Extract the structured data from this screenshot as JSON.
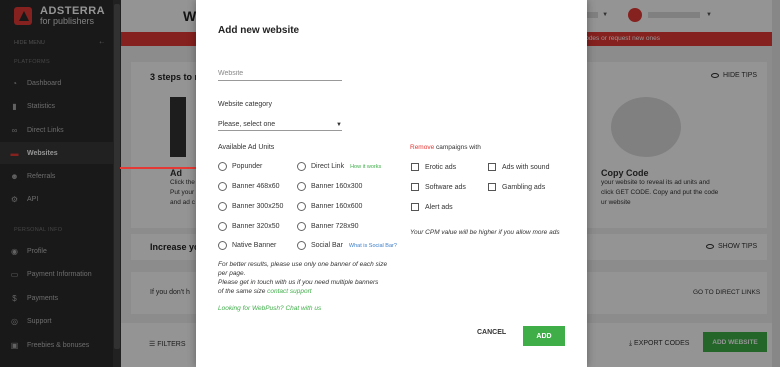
{
  "sidebar": {
    "logo_title": "ADSTERRA",
    "logo_sub": "for publishers",
    "hide_menu": "HIDE MENU",
    "platforms_label": "PLATFORMS",
    "personal_label": "PERSONAL INFO",
    "items": [
      {
        "label": "Dashboard",
        "icon": "dashboard-icon"
      },
      {
        "label": "Statistics",
        "icon": "statistics-icon"
      },
      {
        "label": "Direct Links",
        "icon": "link-icon"
      },
      {
        "label": "Websites",
        "icon": "websites-icon"
      },
      {
        "label": "Referrals",
        "icon": "referrals-icon"
      },
      {
        "label": "API",
        "icon": "api-icon"
      },
      {
        "label": "Profile",
        "icon": "profile-icon"
      },
      {
        "label": "Payment Information",
        "icon": "payment-icon"
      },
      {
        "label": "Payments",
        "icon": "dollar-icon"
      },
      {
        "label": "Support",
        "icon": "support-icon"
      },
      {
        "label": "Freebies & bonuses",
        "icon": "gift-icon"
      }
    ]
  },
  "main": {
    "page_title": "We",
    "banner_text": "the your codes or request new ones",
    "steps_title": "3 steps to m",
    "hide_tips": "HIDE TIPS",
    "step_1": {
      "head": "Ad",
      "lines": [
        "Click the",
        "Put your",
        "and ad c"
      ]
    },
    "step_3": {
      "head": "Copy Code",
      "lines": [
        "your website to reveal its ad units and",
        "click GET CODE. Copy and put the code",
        "ur website"
      ]
    },
    "increase_title": "Increase yo",
    "show_tips": "SHOW TIPS",
    "direct_links_text": "If you don't h",
    "go_direct_links": "GO TO DIRECT LINKS",
    "filters": "FILTERS",
    "export_codes": "EXPORT CODES",
    "add_website": "ADD WEBSITE"
  },
  "modal": {
    "title": "Add new website",
    "website_placeholder": "Website",
    "category_label": "Website category",
    "category_value": "Please, select one",
    "ad_units_label": "Available Ad Units",
    "ad_units": [
      {
        "label": "Popunder",
        "help": ""
      },
      {
        "label": "Direct Link",
        "help": "How it works"
      },
      {
        "label": "Banner 468x60",
        "help": ""
      },
      {
        "label": "Banner 160x300",
        "help": ""
      },
      {
        "label": "Banner 300x250",
        "help": ""
      },
      {
        "label": "Banner 160x600",
        "help": ""
      },
      {
        "label": "Banner 320x50",
        "help": ""
      },
      {
        "label": "Banner 728x90",
        "help": ""
      },
      {
        "label": "Native Banner",
        "help": ""
      },
      {
        "label": "Social Bar",
        "help": "What is Social Bar?"
      }
    ],
    "remove_word": "Remove",
    "remove_rest": " campaigns with",
    "campaigns": [
      {
        "label": "Erotic ads"
      },
      {
        "label": "Ads with sound"
      },
      {
        "label": "Software ads"
      },
      {
        "label": "Gambling ads"
      },
      {
        "label": "Alert ads"
      }
    ],
    "cpm_note": "Your CPM value will be higher if you allow more ads",
    "note_1": "For better results, please use only one banner of each size",
    "note_2": "per page.",
    "note_3": "Please get in touch with us if you need multiple banners",
    "note_4a": "of the same size ",
    "note_4b": "contact support",
    "webpush": "Looking for WebPush? Chat with us",
    "cancel": "CANCEL",
    "add": "ADD"
  },
  "colors": {
    "accent_red": "#e53935",
    "accent_green": "#3fae49"
  }
}
